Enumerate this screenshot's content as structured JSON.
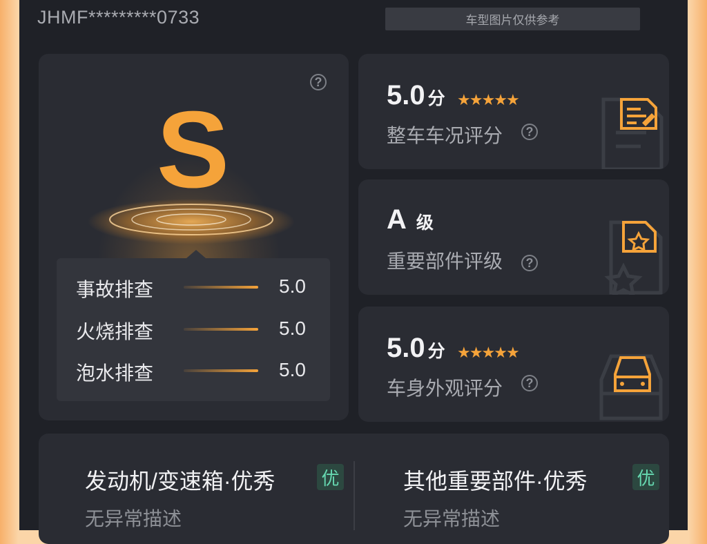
{
  "header": {
    "vin": "JHMF*********0733",
    "ref_note": "车型图片仅供参考"
  },
  "overall": {
    "grade": "S",
    "checks": [
      {
        "label": "事故排查",
        "value": "5.0"
      },
      {
        "label": "火烧排查",
        "value": "5.0"
      },
      {
        "label": "泡水排查",
        "value": "5.0"
      }
    ]
  },
  "cards": [
    {
      "score": "5.0",
      "unit": "分",
      "stars": 5,
      "label": "整车车况评分",
      "icon": "document-edit-icon"
    },
    {
      "score": "A",
      "unit": "级",
      "label": "重要部件评级",
      "icon": "document-star-icon"
    },
    {
      "score": "5.0",
      "unit": "分",
      "stars": 5,
      "label": "车身外观评分",
      "icon": "car-front-icon"
    }
  ],
  "sections": [
    {
      "title": "发动机/变速箱·优秀",
      "badge": "优",
      "desc": "无异常描述"
    },
    {
      "title": "其他重要部件·优秀",
      "badge": "优",
      "desc": "无异常描述"
    }
  ],
  "colors": {
    "accent": "#f5a33a",
    "badge_text": "#66d8b0",
    "panel": "#1f2127",
    "card": "#2a2c33"
  }
}
